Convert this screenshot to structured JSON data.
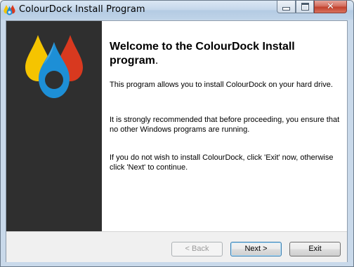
{
  "window": {
    "title": "ColourDock Install Program",
    "close_symbol": "✕",
    "icons": {
      "app": "colourdock-drops-icon",
      "minimize": "minimize-icon",
      "maximize": "maximize-icon",
      "close": "close-icon"
    }
  },
  "sidebar": {
    "logo": "colourdock-drops-logo",
    "colors": {
      "yellow": "#f5c400",
      "red": "#d8391f",
      "blue": "#1d8fd6",
      "background": "#2f2f2f"
    }
  },
  "content": {
    "heading": "Welcome to the ColourDock Install program",
    "heading_end": ".",
    "paragraph1": "This program allows you to install ColourDock on your hard drive.",
    "paragraph2": "It is strongly recommended that before proceeding, you ensure that no other Windows programs are running.",
    "paragraph3": "If you do not wish to install ColourDock, click 'Exit' now, otherwise click 'Next' to continue."
  },
  "footer": {
    "back_label": "< Back",
    "next_label": "Next >",
    "exit_label": "Exit"
  }
}
